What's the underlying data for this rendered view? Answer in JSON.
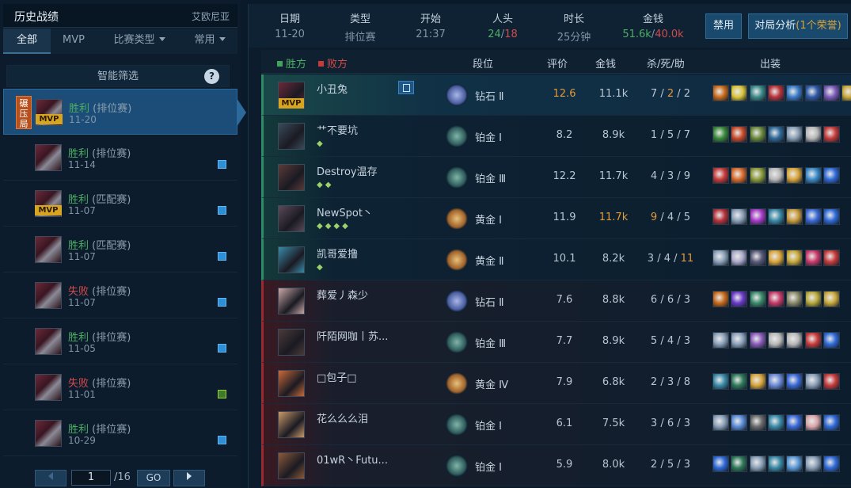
{
  "left": {
    "title": "历史战绩",
    "server": "艾欧尼亚",
    "tabs": [
      "全部",
      "MVP",
      "比赛类型",
      "常用"
    ],
    "smart_filter": "智能筛选",
    "help": "?",
    "games": [
      {
        "badge": "碾压局",
        "mvp": "MVP",
        "result": "胜利",
        "mode": "(排位赛)",
        "date": "11-20",
        "win": true
      },
      {
        "result": "胜利",
        "mode": "(排位赛)",
        "date": "11-14",
        "win": true
      },
      {
        "mvp": "MVP",
        "result": "胜利",
        "mode": "(匹配赛)",
        "date": "11-07",
        "win": true
      },
      {
        "result": "胜利",
        "mode": "(匹配赛)",
        "date": "11-07",
        "win": true
      },
      {
        "result": "失败",
        "mode": "(排位赛)",
        "date": "11-07",
        "win": false
      },
      {
        "result": "胜利",
        "mode": "(排位赛)",
        "date": "11-05",
        "win": true
      },
      {
        "result": "失败",
        "mode": "(排位赛)",
        "date": "11-01",
        "win": false
      },
      {
        "result": "胜利",
        "mode": "(排位赛)",
        "date": "10-29",
        "win": true
      }
    ],
    "pager": {
      "page": "1",
      "total": "/16",
      "go": "GO"
    }
  },
  "summary": {
    "date_h": "日期",
    "date_v": "11-20",
    "type_h": "类型",
    "type_v": "排位赛",
    "start_h": "开始",
    "start_v": "21:37",
    "kills_h": "人头",
    "kills_a": "24",
    "kills_sep": "/",
    "kills_b": "18",
    "dur_h": "时长",
    "dur_v": "25分钟",
    "gold_h": "金钱",
    "gold_a": "51.6k",
    "gold_sep": "/",
    "gold_b": "40.0k",
    "ban_btn": "禁用",
    "analysis_btn": "对局分析",
    "analysis_hl": "(1个荣誉)"
  },
  "table": {
    "win_side": "胜方",
    "lose_side": "败方",
    "col_rank": "段位",
    "col_rating": "评价",
    "col_gold": "金钱",
    "col_kda": "杀/死/助",
    "col_items": "出装",
    "win_color": "#3fa35a",
    "lose_color": "#c83a3a",
    "players": [
      {
        "name": "小丑兔",
        "mvp": "MVP",
        "rank": "钻石 Ⅱ",
        "tier": "dia",
        "rating": "12.6",
        "gold": "11.1k",
        "k": "7",
        "d": "2",
        "a": "2",
        "team": "w",
        "highlight": true,
        "d_hl": true,
        "rating_hl": true,
        "tags": ""
      },
      {
        "name": "艹不要坑",
        "rank": "铂金 Ⅰ",
        "tier": "plat",
        "rating": "8.2",
        "gold": "8.9k",
        "k": "1",
        "d": "5",
        "a": "7",
        "team": "w",
        "tags": "◆"
      },
      {
        "name": "Destroy温存",
        "rank": "铂金 Ⅲ",
        "tier": "plat",
        "rating": "12.2",
        "gold": "11.7k",
        "k": "4",
        "d": "3",
        "a": "9",
        "team": "w",
        "tags": "◆◆"
      },
      {
        "name": "NewSpot丶",
        "rank": "黄金 Ⅰ",
        "tier": "gold",
        "rating": "11.9",
        "gold": "11.7k",
        "k": "9",
        "d": "4",
        "a": "5",
        "team": "w",
        "gold_hl": true,
        "k_hl": true,
        "tags": "◆◆◆◆"
      },
      {
        "name": "凯哥爱撸",
        "rank": "黄金 Ⅱ",
        "tier": "gold",
        "rating": "10.1",
        "gold": "8.2k",
        "k": "3",
        "d": "4",
        "a": "11",
        "team": "w",
        "a_hl": true,
        "tags": "◆"
      },
      {
        "name": "葬爱丿森少",
        "rank": "钻石 Ⅱ",
        "tier": "dia",
        "rating": "7.6",
        "gold": "8.8k",
        "k": "6",
        "d": "6",
        "a": "3",
        "team": "l",
        "tags": ""
      },
      {
        "name": "阡陌网咖丨苏...",
        "rank": "铂金 Ⅲ",
        "tier": "plat",
        "rating": "7.7",
        "gold": "8.9k",
        "k": "5",
        "d": "4",
        "a": "3",
        "team": "l",
        "tags": ""
      },
      {
        "name": "□包子□",
        "rank": "黄金 Ⅳ",
        "tier": "gold",
        "rating": "7.9",
        "gold": "6.8k",
        "k": "2",
        "d": "3",
        "a": "8",
        "team": "l",
        "tags": ""
      },
      {
        "name": "花么么么泪",
        "rank": "铂金 Ⅰ",
        "tier": "plat",
        "rating": "6.1",
        "gold": "7.5k",
        "k": "3",
        "d": "6",
        "a": "3",
        "team": "l",
        "tags": ""
      },
      {
        "name": "01wR丶Futu...",
        "rank": "铂金 Ⅰ",
        "tier": "plat",
        "rating": "5.9",
        "gold": "8.0k",
        "k": "2",
        "d": "5",
        "a": "3",
        "team": "l",
        "tags": ""
      }
    ]
  }
}
